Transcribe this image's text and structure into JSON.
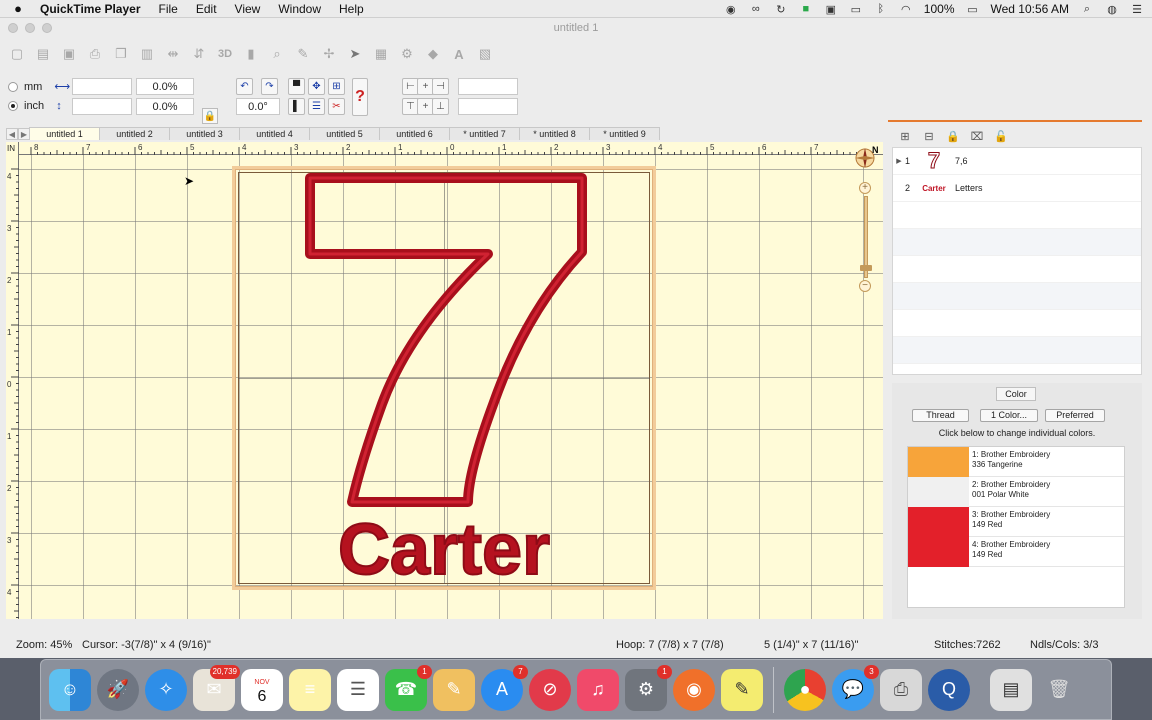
{
  "menubar": {
    "app_name": "QuickTime Player",
    "items": [
      "File",
      "Edit",
      "View",
      "Window",
      "Help"
    ],
    "battery": "100%",
    "clock": "Wed 10:56 AM"
  },
  "window": {
    "title": "untitled 1"
  },
  "units": {
    "mm_label": "mm",
    "inch_label": "inch",
    "width_value": "",
    "height_value": "",
    "width_pct": "0.0%",
    "height_pct": "0.0%",
    "rotation": "0.0°"
  },
  "tabs": [
    "untitled 1",
    "untitled 2",
    "untitled 3",
    "untitled 4",
    "untitled 5",
    "untitled 6",
    "* untitled 7",
    "* untitled 8",
    "* untitled 9"
  ],
  "ruler": {
    "unit": "IN",
    "top_ticks": [
      "8",
      "7",
      "6",
      "5",
      "4",
      "3",
      "2",
      "1",
      "0",
      "1",
      "2",
      "3",
      "4",
      "5",
      "6",
      "7"
    ],
    "left_ticks": [
      "4",
      "3",
      "2",
      "1",
      "0",
      "1",
      "2",
      "3",
      "4"
    ]
  },
  "design": {
    "numeral": "7",
    "name_text": "Carter",
    "outline_color": "#b0101e",
    "fill_color": "#c01526"
  },
  "compass_label": "N",
  "layers": [
    {
      "index": "1",
      "thumb": "7",
      "name": "7,6"
    },
    {
      "index": "2",
      "thumb": "Carter",
      "name": "Letters"
    }
  ],
  "color_panel": {
    "title": "Color",
    "buttons": [
      "Thread",
      "1 Color...",
      "Preferred"
    ],
    "note": "Click below to change individual colors.",
    "threads": [
      {
        "line1": "1: Brother Embroidery",
        "line2": "336 Tangerine",
        "color": "#f7a43a"
      },
      {
        "line1": "2: Brother Embroidery",
        "line2": "001 Polar White",
        "color": "#f0f0f0"
      },
      {
        "line1": "3: Brother Embroidery",
        "line2": "149 Red",
        "color": "#e3202a"
      },
      {
        "line1": "4: Brother Embroidery",
        "line2": "149 Red",
        "color": "#e3202a"
      }
    ]
  },
  "status": {
    "zoom": "Zoom: 45%",
    "cursor": "Cursor: -3(7/8)\" x 4 (9/16)\"",
    "hoop": "Hoop: 7 (7/8) x 7 (7/8)",
    "size": "5 (1/4)\" x 7 (11/16)\"",
    "stitches": "Stitches:7262",
    "needles": "Ndls/Cols: 3/3"
  },
  "dock": {
    "photos_badge": "20,739",
    "calendar_month": "NOV",
    "calendar_day": "6",
    "facetime_badge": "1",
    "appstore_badge": "7",
    "prefs_badge": "1",
    "messages_badge": "3"
  }
}
